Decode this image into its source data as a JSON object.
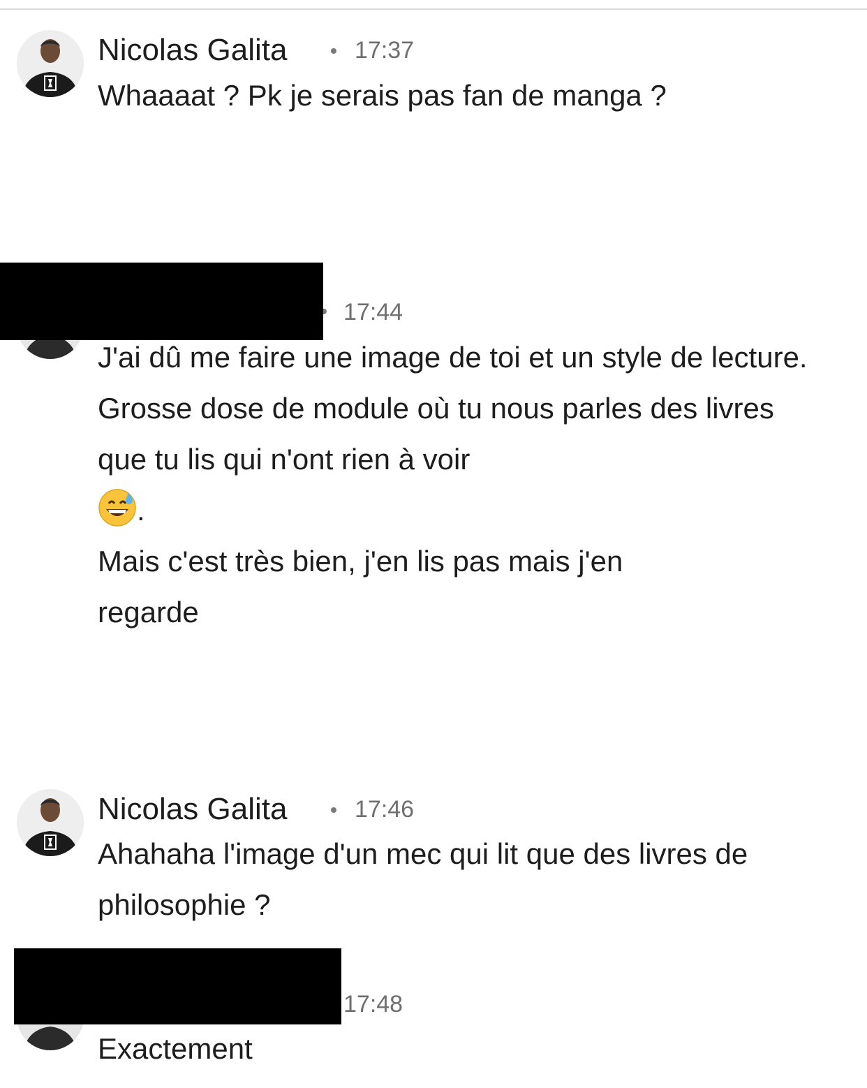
{
  "messages": [
    {
      "sender": "Nicolas Galita",
      "time": "17:37",
      "lines": [
        "Whaaaat ? Pk je serais pas fan de manga ?"
      ]
    },
    {
      "sender": "",
      "time": "17:44",
      "lines": [
        "J'ai dû me faire une image de toi et un style de lecture. Grosse dose de module où tu nous parles des livres que tu lis qui n'ont rien à voir",
        ".",
        "Mais c'est très bien, j'en lis pas mais j'en regarde"
      ],
      "emoji": "grinning-face-with-sweat"
    },
    {
      "sender": "Nicolas Galita",
      "time": "17:46",
      "lines": [
        "Ahahaha l'image d'un mec qui lit que des livres de philosophie ?"
      ]
    },
    {
      "sender": "",
      "time": "17:48",
      "lines": [
        "Exactement"
      ]
    }
  ],
  "icons": {
    "avatar_nicolas": "avatar-icon",
    "emoji": "grinning-face-with-sweat-icon"
  },
  "colors": {
    "redaction": "#000000",
    "timestamp": "#6f6f6f",
    "text": "#1d1d1d"
  }
}
